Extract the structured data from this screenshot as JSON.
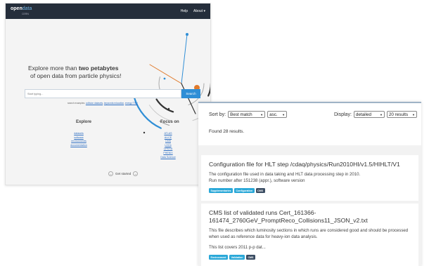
{
  "portal": {
    "logo": {
      "open": "open",
      "data": "data",
      "sub": "CERN"
    },
    "nav": {
      "help": "Help",
      "about": "About",
      "about_caret": "▾"
    },
    "headline": {
      "line1_prefix": "Explore more than ",
      "line1_bold": "two petabytes",
      "line2": "of open data from particle physics!"
    },
    "search": {
      "placeholder": "Start typing...",
      "button": "Search"
    },
    "examples": {
      "label": "search examples:",
      "ex1": "collision datasets",
      "ex2": "keywords:education",
      "ex3": "energy:7TeV"
    },
    "explore": {
      "heading": "Explore",
      "links": [
        "datasets",
        "software",
        "environments",
        "documentation"
      ]
    },
    "focus": {
      "heading": "Focus on",
      "links": [
        "ATLAS",
        "ALICE",
        "CMS",
        "LHCb",
        "OPERA",
        "PHENIX",
        "Data Science"
      ]
    },
    "get_started": "Get started",
    "colors": {
      "topbar": "#252e3b",
      "accent": "#2f8ed6"
    }
  },
  "results": {
    "sort_label": "Sort by:",
    "sort_value": "Best match",
    "order_value": "asc.",
    "display_label": "Display:",
    "display_value": "detailed",
    "count_value": "20 results",
    "found": "Found 28 results.",
    "items": [
      {
        "title": "Configuration file for HLT step /cdaq/physics/Run2010HI/v1.5/HIHLT/V1",
        "desc": "The configuration file used in data taking and HLT data processing step in 2010.",
        "desc2": "Run number after 151238 (appr.), software version",
        "tags": [
          {
            "label": "Supplementaries",
            "color": "#2aa8d8"
          },
          {
            "label": "Configuration",
            "color": "#2aa8d8"
          },
          {
            "label": "CMS",
            "color": "#3b4d63"
          }
        ]
      },
      {
        "title": "CMS list of validated runs Cert_161366-161474_2760GeV_PromptReco_Collisions11_JSON_v2.txt",
        "desc": "This file describes which luminosity sections in which runs are considered good and should be processed when used as reference data for heavy-ion data analysis.",
        "desc2": "This list covers 2011 p-p dat...",
        "tags": [
          {
            "label": "Environment",
            "color": "#2aa8d8"
          },
          {
            "label": "Validation",
            "color": "#2aa8d8"
          },
          {
            "label": "CMS",
            "color": "#3b4d63"
          }
        ]
      }
    ]
  }
}
